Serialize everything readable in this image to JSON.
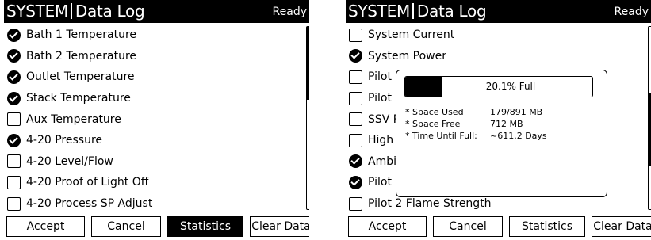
{
  "left_screen": {
    "title_app": "SYSTEM",
    "title_page": "Data Log",
    "status": "Ready",
    "items": [
      {
        "label": "Bath 1 Temperature",
        "checked": true
      },
      {
        "label": "Bath 2 Temperature",
        "checked": true
      },
      {
        "label": "Outlet Temperature",
        "checked": true
      },
      {
        "label": "Stack Temperature",
        "checked": true
      },
      {
        "label": "Aux Temperature",
        "checked": false
      },
      {
        "label": "4-20 Pressure",
        "checked": true
      },
      {
        "label": "4-20 Level/Flow",
        "checked": false
      },
      {
        "label": "4-20 Proof of Light Off",
        "checked": false
      },
      {
        "label": "4-20 Process SP Adjust",
        "checked": false
      }
    ],
    "scroll_position": 0,
    "buttons": {
      "accept": "Accept",
      "cancel": "Cancel",
      "statistics": "Statistics",
      "clear": "Clear Data"
    },
    "active_button": "statistics"
  },
  "right_screen": {
    "title_app": "SYSTEM",
    "title_page": "Data Log",
    "status": "Ready",
    "items": [
      {
        "label": "System Current",
        "checked": false
      },
      {
        "label": "System Power",
        "checked": true
      },
      {
        "label": "Pilot 1",
        "checked": false
      },
      {
        "label": "Pilot 2",
        "checked": false
      },
      {
        "label": "SSV R",
        "checked": false
      },
      {
        "label": "High",
        "checked": false
      },
      {
        "label": "Ambi",
        "checked": true
      },
      {
        "label": "Pilot 1",
        "checked": true
      },
      {
        "label": "Pilot 2 Flame Strength",
        "checked": false
      }
    ],
    "scroll_position": 0.6,
    "buttons": {
      "accept": "Accept",
      "cancel": "Cancel",
      "statistics": "Statistics",
      "clear": "Clear Data"
    },
    "active_button": "",
    "dialog": {
      "progress_label": "20.1% Full",
      "fill_fraction": 0.201,
      "stats": [
        {
          "label": "* Space Used",
          "value": "179/891 MB"
        },
        {
          "label": "* Space Free",
          "value": "712 MB"
        },
        {
          "label": "* Time Until Full:",
          "value": "~611.2 Days"
        }
      ]
    }
  },
  "colors": {
    "foreground": "#000000",
    "background": "#ffffff"
  },
  "icons": {
    "checked": "check-circle-icon",
    "unchecked": "empty-checkbox-icon"
  }
}
